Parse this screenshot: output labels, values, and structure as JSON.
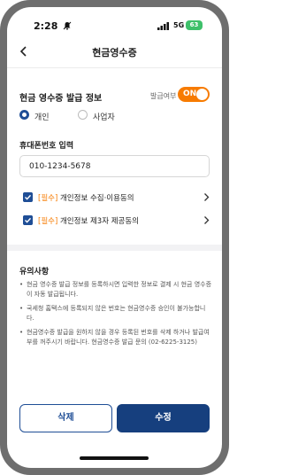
{
  "status_bar": {
    "time": "2:28",
    "network": "5G",
    "battery": "63"
  },
  "header": {
    "title": "현금영수증"
  },
  "receipt": {
    "section_title": "현금 영수증 발급 정보",
    "toggle_label": "발급여부",
    "toggle_state": "ON",
    "options": [
      {
        "label": "개인",
        "selected": true
      },
      {
        "label": "사업자",
        "selected": false
      }
    ],
    "phone_label": "휴대폰번호 입력",
    "phone_value": "010-1234-5678"
  },
  "agreements": [
    {
      "required_tag": "[필수]",
      "label": "개인정보 수집·이용동의"
    },
    {
      "required_tag": "[필수]",
      "label": "개인정보 제3자 제공동의"
    }
  ],
  "notice": {
    "title": "유의사항",
    "items": [
      "현금 영수증 발급 정보를 등록하시면 입력한 정보로 결제 시 현금 영수증이 자동 발급됩니다.",
      "국세청 홈택스에 등록되지 않은 번호는 현금영수증 승인이 불가능합니다.",
      "현금영수증 발급을 원하지 않을 경우 등록된 번호를 삭제 하거나 발급여부를 꺼주시기 바랍니다. 현금영수증 발급 문의 (02-6225-3125)"
    ]
  },
  "buttons": {
    "delete": "삭제",
    "edit": "수정"
  },
  "colors": {
    "accent": "#f77b00",
    "primary": "#163f7e",
    "check": "#1f4e96"
  }
}
